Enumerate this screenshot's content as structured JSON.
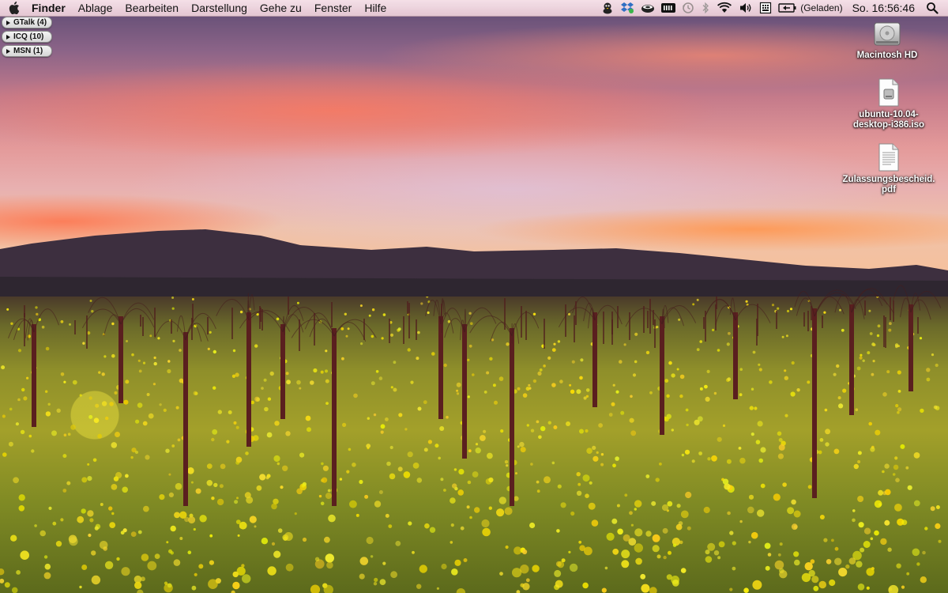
{
  "menubar": {
    "apple_icon": "apple-icon",
    "app_name": "Finder",
    "menus": [
      "Ablage",
      "Bearbeiten",
      "Darstellung",
      "Gehe zu",
      "Fenster",
      "Hilfe"
    ],
    "status_icons": [
      "adium-duck-icon",
      "dropbox-icon",
      "growl-icon",
      "memory-meter-icon",
      "time-machine-icon",
      "bluetooth-icon",
      "wifi-icon",
      "volume-icon",
      "input-menu-icon",
      "battery-icon"
    ],
    "battery_status": "(Geladen)",
    "clock": "So. 16:56:46",
    "spotlight_icon": "spotlight-search-icon"
  },
  "buddy_groups": [
    {
      "label": "GTalk (4)"
    },
    {
      "label": "ICQ (10)"
    },
    {
      "label": "MSN (1)"
    }
  ],
  "desktop_icons": [
    {
      "label": "Macintosh HD",
      "icon": "hard-drive-icon"
    },
    {
      "label": "ubuntu-10.04-desktop-i386.iso",
      "icon": "disk-image-file-icon"
    },
    {
      "label": "Zulassungsbescheid.pdf",
      "icon": "pdf-document-icon"
    }
  ],
  "colors": {
    "menubar": "#f2dde4",
    "label_text": "#ffffff"
  }
}
